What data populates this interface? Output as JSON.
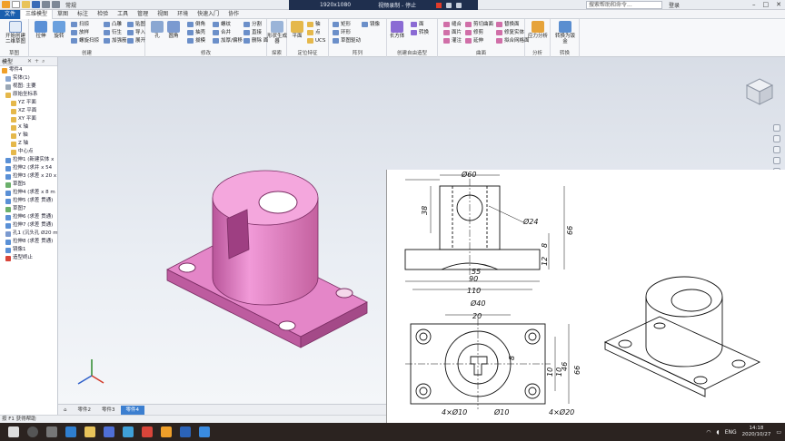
{
  "titlebar": {
    "document_title": "常规",
    "recorder_resolution": "1920x1080",
    "recorder_status": "视频录制 - 停止",
    "help_search_placeholder": "搜索帮助和命令...",
    "signin_label": "登录"
  },
  "tabs": [
    "文件",
    "三维模型",
    "草图",
    "标注",
    "检验",
    "工具",
    "管理",
    "视图",
    "环境",
    "快速入门",
    "协作"
  ],
  "active_tab": "三维模型",
  "ribbon": {
    "sketch": {
      "label": "草图",
      "start_2d": "开始创建二维草图"
    },
    "create": {
      "label": "创建",
      "extrude": "拉伸",
      "revolve": "旋转",
      "small": [
        "扫掠",
        "放样",
        "螺旋扫掠",
        "凸雕",
        "衍生",
        "加强筋",
        "贴图",
        "导入",
        "展开"
      ]
    },
    "modify": {
      "label": "修改",
      "hole": "孔",
      "fillet": "圆角",
      "small": [
        "倒角",
        "抽壳",
        "拔模",
        "螺纹",
        "合并",
        "加厚/偏移",
        "分割",
        "直接",
        "删除 面"
      ]
    },
    "explore": {
      "label": "探索",
      "shape_gen": "形状生成器"
    },
    "work_features": {
      "label": "定位特征",
      "plane": "平面",
      "small": [
        "轴",
        "点",
        "UCS"
      ]
    },
    "pattern": {
      "label": "阵列",
      "small": [
        "矩形",
        "环形",
        "草图驱动",
        "镜像"
      ]
    },
    "freeform": {
      "label": "创建自由造型",
      "box": "长方体",
      "small": [
        "面",
        "转换"
      ]
    },
    "surface": {
      "label": "曲面",
      "small": [
        "缝合",
        "面片",
        "灌注",
        "剪切曲面",
        "修剪",
        "延伸",
        "替换面",
        "修复实体",
        "拟合网格面"
      ]
    },
    "simulation": {
      "label": "分析",
      "stress": "应力分析"
    },
    "convert": {
      "label": "转换",
      "sheetmetal": "转换为钣金"
    }
  },
  "browser": {
    "title": "模型",
    "items": [
      "零件4",
      "实体(1)",
      "视图: 主要",
      "原始坐标系",
      "YZ 平面",
      "XZ 平面",
      "XY 平面",
      "X 轴",
      "Y 轴",
      "Z 轴",
      "中心点",
      "拉伸1 (新建实体 x",
      "拉伸2 (求并 x 54",
      "拉伸3 (求差 x 20 x",
      "草图5",
      "拉伸4 (求差 x 8 m",
      "拉伸5 (求差 贯通)",
      "草图7",
      "拉伸6 (求差 贯通)",
      "拉伸7 (求差 贯通)",
      "孔1 (沉头孔 Ø20 m",
      "拉伸8 (求差 贯通)",
      "镜像1",
      "造型终止"
    ]
  },
  "doc_tabs": [
    "零件2",
    "零件3",
    "零件4"
  ],
  "active_doc": "零件4",
  "statusbar": "按 F1 获得帮助",
  "taskbar": {
    "time": "14:18",
    "date": "2020/10/27",
    "lang": "ENG"
  },
  "drawing": {
    "dims_front": [
      "Ø60",
      "38",
      "Ø24",
      "8",
      "12",
      "66",
      "55",
      "90",
      "110"
    ],
    "dims_top": [
      "Ø40",
      "20",
      "8",
      "10",
      "10",
      "46",
      "66",
      "4×Ø10",
      "Ø10",
      "4×Ø20"
    ]
  },
  "colors": {
    "accent": "#1b5fae",
    "part": "#e07cc4",
    "part_dark": "#b14f97"
  }
}
